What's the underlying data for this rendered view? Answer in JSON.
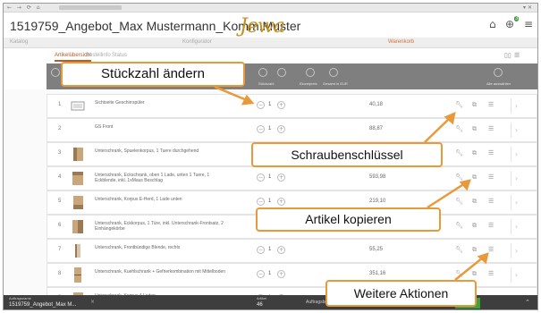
{
  "browser": {
    "nav_glyphs": "← → ⟳ ⌂",
    "window_controls": "▾ ✕"
  },
  "app": {
    "title": "1519759_Angebot_Max Mustermann_Komm.Muster",
    "logo": "Jewa",
    "cart_count": "3",
    "icons": {
      "home": "home-icon",
      "cart": "cart-icon",
      "menu": "hamburger-menu-icon"
    }
  },
  "category_bar": {
    "left": "Katalog",
    "middle": "Konfigurator",
    "right": "Warenkorb"
  },
  "tabs": [
    {
      "label": "Artikelübersicht"
    },
    {
      "label": "Bestellinfo"
    },
    {
      "label": "Status"
    }
  ],
  "header": {
    "qty_label": "Stückzahl",
    "col_a": "Einzelpreis",
    "col_b": "Gesamt in EUR",
    "col_c": "Alle auswählen"
  },
  "rows": [
    {
      "num": "1",
      "desc": "Sichtseite Geschirrspüler",
      "qty": "1",
      "price": "40,18"
    },
    {
      "num": "2",
      "desc": "GS Front",
      "qty": "1",
      "price": "88,87"
    },
    {
      "num": "3",
      "desc": "Unterschrank, Spuelenkorpus, 1 Tuere durchgehend",
      "qty": "1",
      "price": ""
    },
    {
      "num": "4",
      "desc": "Unterschrank, Eckschrank, oben 1 Lade, unten 1 Tuere, 1 Eckblende, inkl. 1xMaus Beschlag",
      "qty": "1",
      "price": "593,98"
    },
    {
      "num": "5",
      "desc": "Unterschrank, Korpus E-Herd, 1 Lade unten",
      "qty": "1",
      "price": "219,10"
    },
    {
      "num": "6",
      "desc": "Unterschrank, Eckkorpus, 1 Türe, inkl. Unterschrank-Frontsatz, 2 Einhängekörbe",
      "qty": "1",
      "price": ""
    },
    {
      "num": "7",
      "desc": "Unterschrank, Frontbündige Blende, rechts",
      "qty": "1",
      "price": "55,25"
    },
    {
      "num": "8",
      "desc": "Unterschrank, Kuehlschrank + Gefrierkombination mit Mittelboden",
      "qty": "1",
      "price": "351,16"
    },
    {
      "num": "9",
      "desc": "Unterschrank, Korpus 4 Laden",
      "qty": "1",
      "price": ""
    }
  ],
  "row_icons": {
    "wrench": "wrench-icon",
    "copy": "copy-icon",
    "more": "more-actions-icon",
    "arrow": "chevron-right-icon"
  },
  "footer": {
    "label_top": "Auftragsname",
    "label_main": "1519759_Angebot_Max M...",
    "qty_top": "Artikel",
    "qty_main": "46",
    "sum_label": "Auftragsbetrag"
  },
  "callouts": {
    "qty": "Stückzahl ändern",
    "wrench": "Schraubenschlüssel",
    "copy": "Artikel kopieren",
    "more": "Weitere Aktionen"
  },
  "colors": {
    "accent": "#e89a3a",
    "logo": "#c7901f",
    "header_bar": "#7f7f7f",
    "footer_bar": "#3e3e3e",
    "confirm_button": "#39a339"
  }
}
